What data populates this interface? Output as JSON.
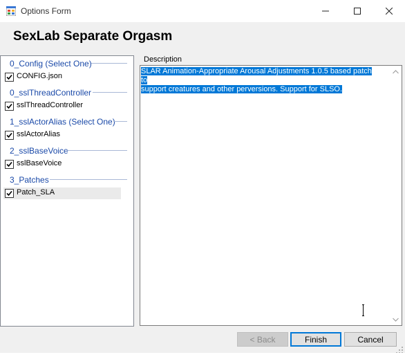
{
  "window": {
    "title": "Options Form",
    "minimize_icon": "minimize-icon",
    "maximize_icon": "maximize-icon",
    "close_icon": "close-icon"
  },
  "header": {
    "title": "SexLab Separate Orgasm"
  },
  "left_panel": {
    "groups": [
      {
        "name": "0_Config (Select One)",
        "items": [
          {
            "label": "CONFIG.json",
            "checked": true
          }
        ]
      },
      {
        "name": "0_sslThreadController",
        "items": [
          {
            "label": "sslThreadController",
            "checked": true
          }
        ]
      },
      {
        "name": "1_sslActorAlias (Select One)",
        "items": [
          {
            "label": "sslActorAlias",
            "checked": true
          }
        ]
      },
      {
        "name": "2_sslBaseVoice",
        "items": [
          {
            "label": "sslBaseVoice",
            "checked": true
          }
        ]
      },
      {
        "name": "3_Patches",
        "items": [
          {
            "label": "Patch_SLA",
            "checked": true,
            "selected": true
          }
        ]
      }
    ]
  },
  "description": {
    "label": "Description",
    "line1": "SLAR Animation-Appropriate Arousal Adjustments 1.0.5 based patch to",
    "line2": "support creatures and other perversions. Support for SLSO."
  },
  "buttons": {
    "back": "< Back",
    "finish": "Finish",
    "cancel": "Cancel"
  },
  "colors": {
    "group_header": "#1a49a8",
    "selection": "#0078d7",
    "accent_border": "#0078d7"
  }
}
